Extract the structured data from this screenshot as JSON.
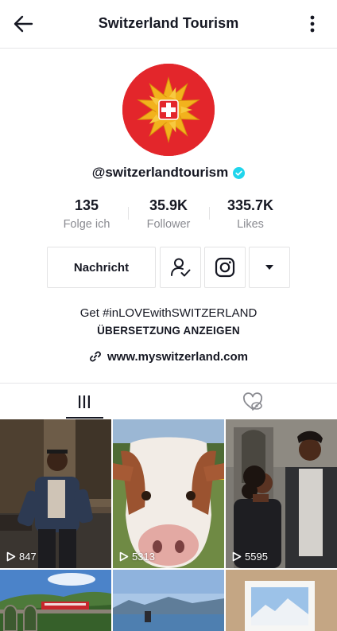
{
  "header": {
    "title": "Switzerland Tourism"
  },
  "profile": {
    "handle": "@switzerlandtourism",
    "verified": true,
    "brand_color": "#e3262b"
  },
  "stats": [
    {
      "value": "135",
      "label": "Folge ich"
    },
    {
      "value": "35.9K",
      "label": "Follower"
    },
    {
      "value": "335.7K",
      "label": "Likes"
    }
  ],
  "actions": {
    "message_label": "Nachricht",
    "follow_icon": "user-check-icon",
    "instagram_icon": "instagram-icon",
    "more_icon": "caret-down-icon"
  },
  "bio": {
    "text": "Get #inLOVEwithSWITZERLAND",
    "translate_label": "ÜBERSETZUNG ANZEIGEN",
    "link": "www.myswitzerland.com"
  },
  "tabs": [
    {
      "name": "videos",
      "icon": "grid-icon",
      "active": true
    },
    {
      "name": "liked",
      "icon": "liked-hidden-icon",
      "active": false
    }
  ],
  "videos": [
    {
      "views": "847"
    },
    {
      "views": "5313"
    },
    {
      "views": "5595"
    },
    {
      "views": ""
    },
    {
      "views": ""
    },
    {
      "views": ""
    }
  ]
}
